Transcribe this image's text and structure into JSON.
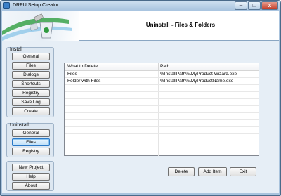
{
  "window": {
    "title": "DRPU Setup Creator"
  },
  "header": {
    "title": "Uninstall - Files & Folders"
  },
  "sidebar": {
    "install": {
      "label": "Install",
      "buttons": [
        "General",
        "Files",
        "Dialogs",
        "Shortcuts",
        "Registry",
        "Save Log",
        "Create"
      ]
    },
    "uninstall": {
      "label": "Uninstall",
      "buttons": [
        "General",
        "Files",
        "Registry"
      ],
      "selected": "Files"
    },
    "bottom_buttons": [
      "New Project",
      "Help",
      "About"
    ]
  },
  "list": {
    "columns": [
      "What to Delete",
      "Path"
    ],
    "rows": [
      {
        "what": "Files",
        "path": "%InstallPath%\\MyProduct Wizard.exe"
      },
      {
        "what": "Folder with Files",
        "path": "%InstallPath%\\MyProductName.exe"
      }
    ]
  },
  "actions": {
    "delete": "Delete",
    "add_item": "Add Item",
    "exit": "Exit"
  },
  "titlebar_controls": {
    "minimize": "–",
    "maximize": "□",
    "close": "x"
  },
  "colors": {
    "accent": "#2b79c7",
    "frame": "#a9c3dd",
    "client": "#e6eef6"
  }
}
